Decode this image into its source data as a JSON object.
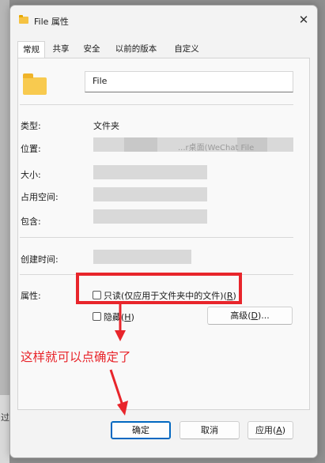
{
  "background": {
    "partial_text": "过"
  },
  "window": {
    "title": "File 属性",
    "close_glyph": "✕"
  },
  "tabs": [
    "常规",
    "共享",
    "安全",
    "以前的版本",
    "自定义"
  ],
  "general": {
    "name_value": "File",
    "type_label": "类型:",
    "type_value": "文件夹",
    "location_label": "位置:",
    "location_partial": "...r桌面(WeChat File",
    "size_label": "大小:",
    "size_on_disk_label": "占用空间:",
    "contains_label": "包含:",
    "created_label": "创建时间:",
    "attributes_label": "属性:",
    "readonly_label": "只读(仅应用于文件夹中的文件)",
    "readonly_key": "R",
    "hidden_label": "隐藏",
    "hidden_key": "H",
    "advanced_label": "高级",
    "advanced_key": "D",
    "advanced_suffix": "..."
  },
  "annotation": {
    "text": "这样就可以点确定了",
    "color": "#e8252b"
  },
  "buttons": {
    "ok": "确定",
    "cancel": "取消",
    "apply": "应用",
    "apply_key": "A"
  },
  "colors": {
    "accent": "#0067c0",
    "annotation_red": "#e8252b",
    "folder_yellow": "#f8ca4f"
  }
}
